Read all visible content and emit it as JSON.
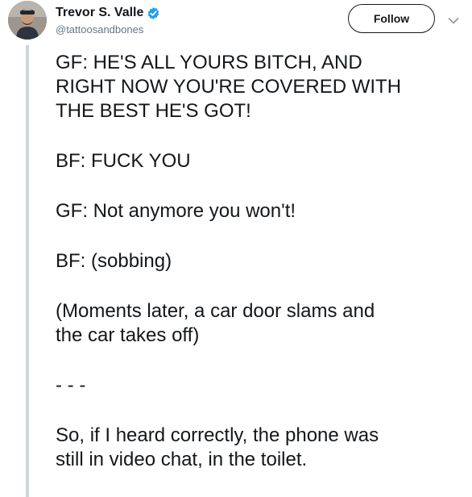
{
  "header": {
    "display_name": "Trevor S. Valle",
    "handle": "@tattoosandbones",
    "follow_label": "Follow",
    "avatar_icon": "user-avatar",
    "verified_icon": "verified-badge-icon",
    "more_icon": "chevron-down-icon"
  },
  "tweet": {
    "paragraphs": [
      "GF: HE'S ALL YOURS BITCH, AND\nRIGHT NOW YOU'RE COVERED WITH\nTHE BEST HE'S GOT!",
      "BF: FUCK YOU",
      "GF: Not anymore you won't!",
      "BF: (sobbing)",
      "(Moments later, a car door slams and\nthe car takes off)",
      "- - -",
      "So, if I heard correctly, the phone was\nstill in video chat, in the toilet."
    ]
  },
  "colors": {
    "text": "#14171a",
    "secondary_text": "#657786",
    "verified_blue": "#1da1f2",
    "thread_line": "#ccd6dd"
  }
}
